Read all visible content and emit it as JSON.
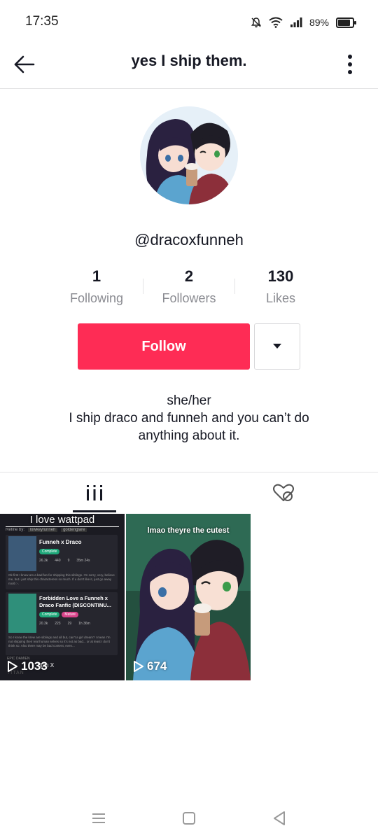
{
  "status_bar": {
    "time": "17:35",
    "battery": "89%",
    "icons": [
      "bell-off-icon",
      "wifi-icon",
      "signal-icon",
      "battery-icon"
    ]
  },
  "header": {
    "title": "yes I ship them."
  },
  "profile": {
    "username": "@dracoxfunneh",
    "stats": [
      {
        "value": "1",
        "label": "Following"
      },
      {
        "value": "2",
        "label": "Followers"
      },
      {
        "value": "130",
        "label": "Likes"
      }
    ],
    "follow_label": "Follow",
    "bio_lines": [
      "she/her",
      "I ship draco and funneh and you can’t do",
      "anything about it."
    ]
  },
  "tabs": [
    {
      "icon": "videos-grid-icon",
      "active": true
    },
    {
      "icon": "liked-hidden-icon",
      "active": false
    }
  ],
  "videos": [
    {
      "caption": "I love wattpad",
      "views": "1033",
      "refine_label": "Refine by:",
      "refine_tags": [
        "lowkeyfunneh",
        "goldenglare"
      ],
      "stories": [
        {
          "title": "Funneh x Draco",
          "badges": [
            "Complete"
          ],
          "stats": [
            "26.3k",
            "440",
            "9",
            "35m 24s"
          ],
          "blurb": "Ok first I know am a bad fan for shipping this siblings. I'm sorry, very, believe me, but i just ship this characteress so much. If u don't like it, just go away noob :-."
        },
        {
          "title": "Forbidden Love a Funneh x Draco Fanfic (DISCONTINU...",
          "badges": [
            "Complete",
            "Mature"
          ],
          "stats": [
            "20.3k",
            "223",
            "29",
            "1h 36m"
          ],
          "blurb": "So I know the krew are siblings and all but, can't a girl dream? I mean I'm not shipping their real human selves so it's not as bad... or at least I don't think so. Also there may be bad content, even..."
        },
        {
          "title": "Titan X",
          "badges": [],
          "stats": [],
          "blurb": ""
        }
      ],
      "section_tag": "EPIC DAMIEN",
      "watermark": "TITAN"
    },
    {
      "caption": "lmao theyre the cutest",
      "views": "674"
    }
  ],
  "colors": {
    "accent": "#fe2c55",
    "text": "#161823",
    "muted": "#8a8b91",
    "divider": "#e3e3e4"
  },
  "nav_bar": {
    "icons": [
      "menu-icon",
      "home-square-icon",
      "back-triangle-icon"
    ]
  }
}
